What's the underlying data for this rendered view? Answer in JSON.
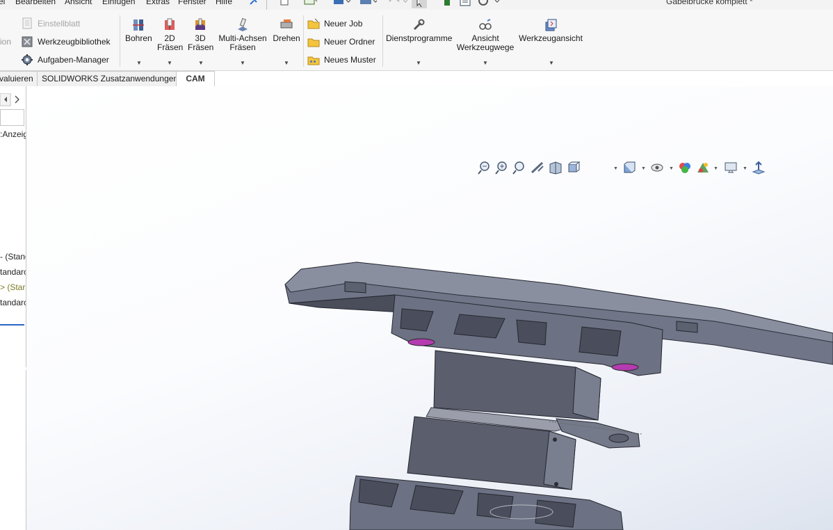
{
  "title_bar": {
    "menus": [
      "ei",
      "Bearbeiten",
      "Ansicht",
      "Einfügen",
      "Extras",
      "Fenster",
      "Hilfe"
    ],
    "document_title": "Gabelbrücke komplett *"
  },
  "ribbon": {
    "left_items": [
      {
        "label": "Einstellblatt",
        "icon": "settings-sheet-icon",
        "enabled": false
      },
      {
        "label": "Werkzeugbibliothek",
        "icon": "tool-library-icon",
        "enabled": true
      },
      {
        "label": "Aufgaben-Manager",
        "icon": "task-manager-icon",
        "enabled": true
      }
    ],
    "left_clip_text": "ion",
    "operations": [
      {
        "label_lines": [
          "Bohren"
        ],
        "icon": "drill-icon"
      },
      {
        "label_lines": [
          "2D",
          "Fräsen"
        ],
        "icon": "mill-2d-icon"
      },
      {
        "label_lines": [
          "3D",
          "Fräsen"
        ],
        "icon": "mill-3d-icon"
      },
      {
        "label_lines": [
          "Multi-Achsen",
          "Fräsen"
        ],
        "icon": "multi-axis-icon"
      },
      {
        "label_lines": [
          "Drehen"
        ],
        "icon": "turning-icon"
      }
    ],
    "new_items": [
      {
        "label": "Neuer Job",
        "icon": "folder-job-icon"
      },
      {
        "label": "Neuer Ordner",
        "icon": "folder-icon"
      },
      {
        "label": "Neues Muster",
        "icon": "pattern-icon"
      }
    ],
    "tools": [
      {
        "label_lines": [
          "Dienstprogramme"
        ],
        "icon": "wrench-icon"
      },
      {
        "label_lines": [
          "Ansicht",
          "Werkzeugwege"
        ],
        "icon": "toolpath-view-icon"
      },
      {
        "label_lines": [
          "Werkzeugansicht"
        ],
        "icon": "tool-view-icon"
      }
    ]
  },
  "tabs": [
    {
      "label": "valuieren",
      "active": false
    },
    {
      "label": "SOLIDWORKS Zusatzanwendungen",
      "active": false
    },
    {
      "label": "CAM",
      "active": true
    }
  ],
  "left_panel": {
    "label_anzeige": ":Anzeig",
    "rows": [
      "- (Stanc",
      "tandarc",
      "> (Star",
      "tandarc"
    ]
  },
  "heads_up_toolbar": [
    "zoom-to-fit-icon",
    "zoom-to-area-icon",
    "previous-view-icon",
    "section-view-icon",
    "dynamic-annotation-icon",
    "view-orientation-icon",
    "display-style-icon",
    "hide-show-items-icon",
    "edit-appearance-icon",
    "apply-scene-icon",
    "view-settings-icon",
    "normal-to-icon"
  ]
}
